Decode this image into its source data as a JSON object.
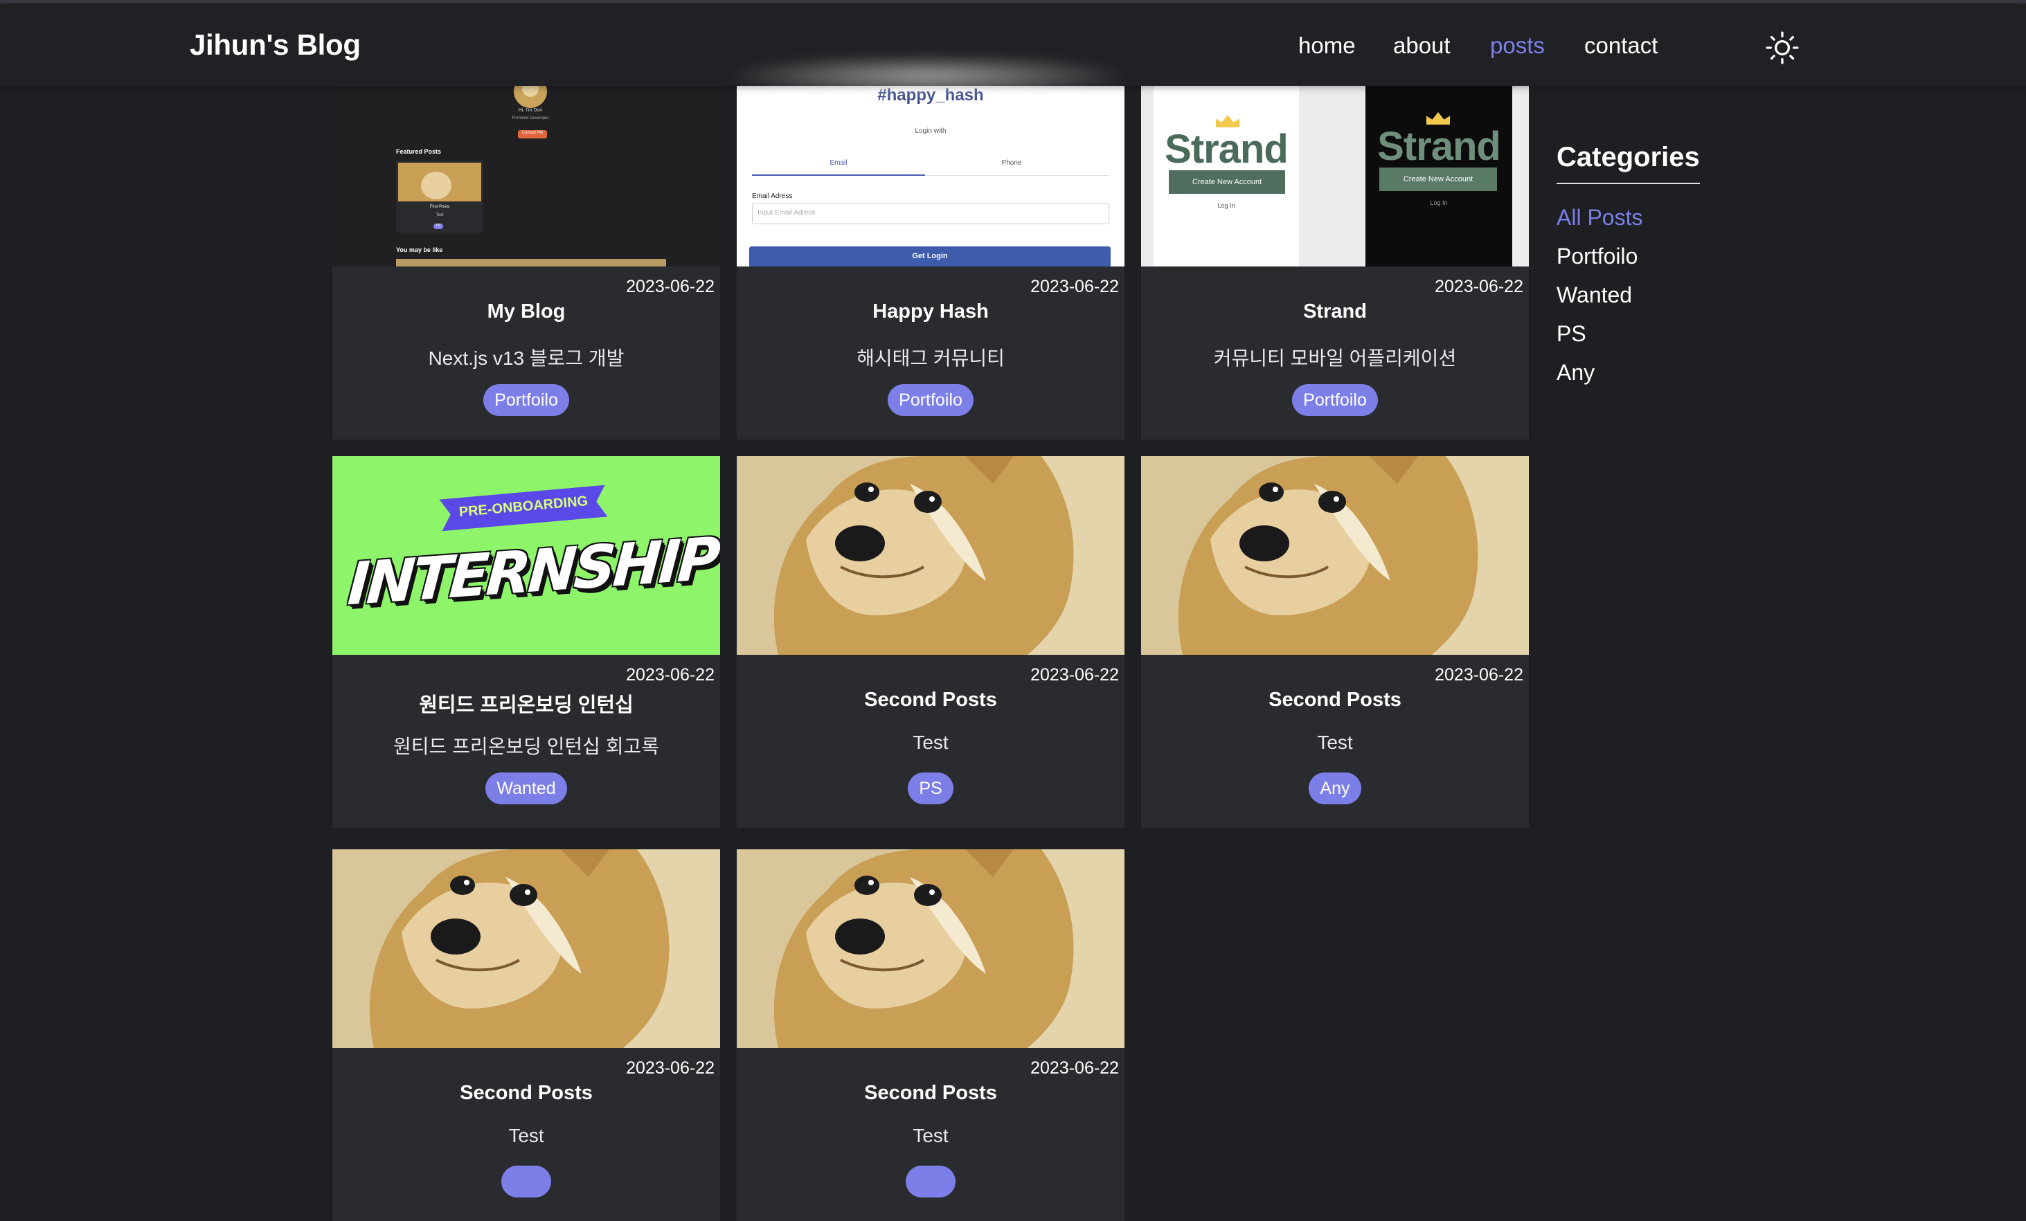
{
  "header": {
    "brand": "Jihun's Blog",
    "nav": [
      {
        "label": "home",
        "active": false
      },
      {
        "label": "about",
        "active": false
      },
      {
        "label": "posts",
        "active": true
      },
      {
        "label": "contact",
        "active": false
      }
    ],
    "theme_icon": "sun-icon"
  },
  "posts": [
    {
      "date": "2023-06-22",
      "title": "My Blog",
      "description": "Next.js v13 블로그 개발",
      "category": "Portfoilo",
      "thumbnail": "blog-screenshot"
    },
    {
      "date": "2023-06-22",
      "title": "Happy Hash",
      "description": "해시태그 커뮤니티",
      "category": "Portfoilo",
      "thumbnail": "login-screenshot"
    },
    {
      "date": "2023-06-22",
      "title": "Strand",
      "description": "커뮤니티 모바일 어플리케이션",
      "category": "Portfoilo",
      "thumbnail": "strand-screenshot"
    },
    {
      "date": "2023-06-22",
      "title": "원티드 프리온보딩 인턴십",
      "description": "원티드 프리온보딩 인턴십 회고록",
      "category": "Wanted",
      "thumbnail": "internship-banner"
    },
    {
      "date": "2023-06-22",
      "title": "Second Posts",
      "description": "Test",
      "category": "PS",
      "thumbnail": "doge"
    },
    {
      "date": "2023-06-22",
      "title": "Second Posts",
      "description": "Test",
      "category": "Any",
      "thumbnail": "doge"
    },
    {
      "date": "2023-06-22",
      "title": "Second Posts",
      "description": "Test",
      "category": "",
      "thumbnail": "doge"
    },
    {
      "date": "2023-06-22",
      "title": "Second Posts",
      "description": "Test",
      "category": "",
      "thumbnail": "doge"
    }
  ],
  "thumbnails": {
    "blog": {
      "hi": "Hi, I'm Dori",
      "sub": "Frontend Developer",
      "contact": "Contact Me",
      "featured": "Featured Posts",
      "first_post": "First Posts",
      "first_desc": "Test",
      "tag": "PS",
      "you_may": "You may be like"
    },
    "happy_hash": {
      "hashtag": "#happy_hash",
      "login_with": "Login with",
      "tab_email": "Email",
      "tab_phone": "Phone",
      "email_label": "Email Adress",
      "email_placeholder": "Input Email Adress",
      "button": "Get Login"
    },
    "strand": {
      "logo": "Strand",
      "button": "Create New Account",
      "login": "Log In"
    },
    "internship": {
      "ribbon": "PRE-ONBOARDING",
      "headline": "INTERNSHIP"
    }
  },
  "categories": {
    "heading": "Categories",
    "items": [
      {
        "label": "All Posts",
        "active": true
      },
      {
        "label": "Portfoilo",
        "active": false
      },
      {
        "label": "Wanted",
        "active": false
      },
      {
        "label": "PS",
        "active": false
      },
      {
        "label": "Any",
        "active": false
      }
    ]
  },
  "colors": {
    "accent": "#7c7fe8",
    "background": "#1e1f22",
    "card": "#2a2b2f",
    "internship_green": "#8ef56b"
  }
}
